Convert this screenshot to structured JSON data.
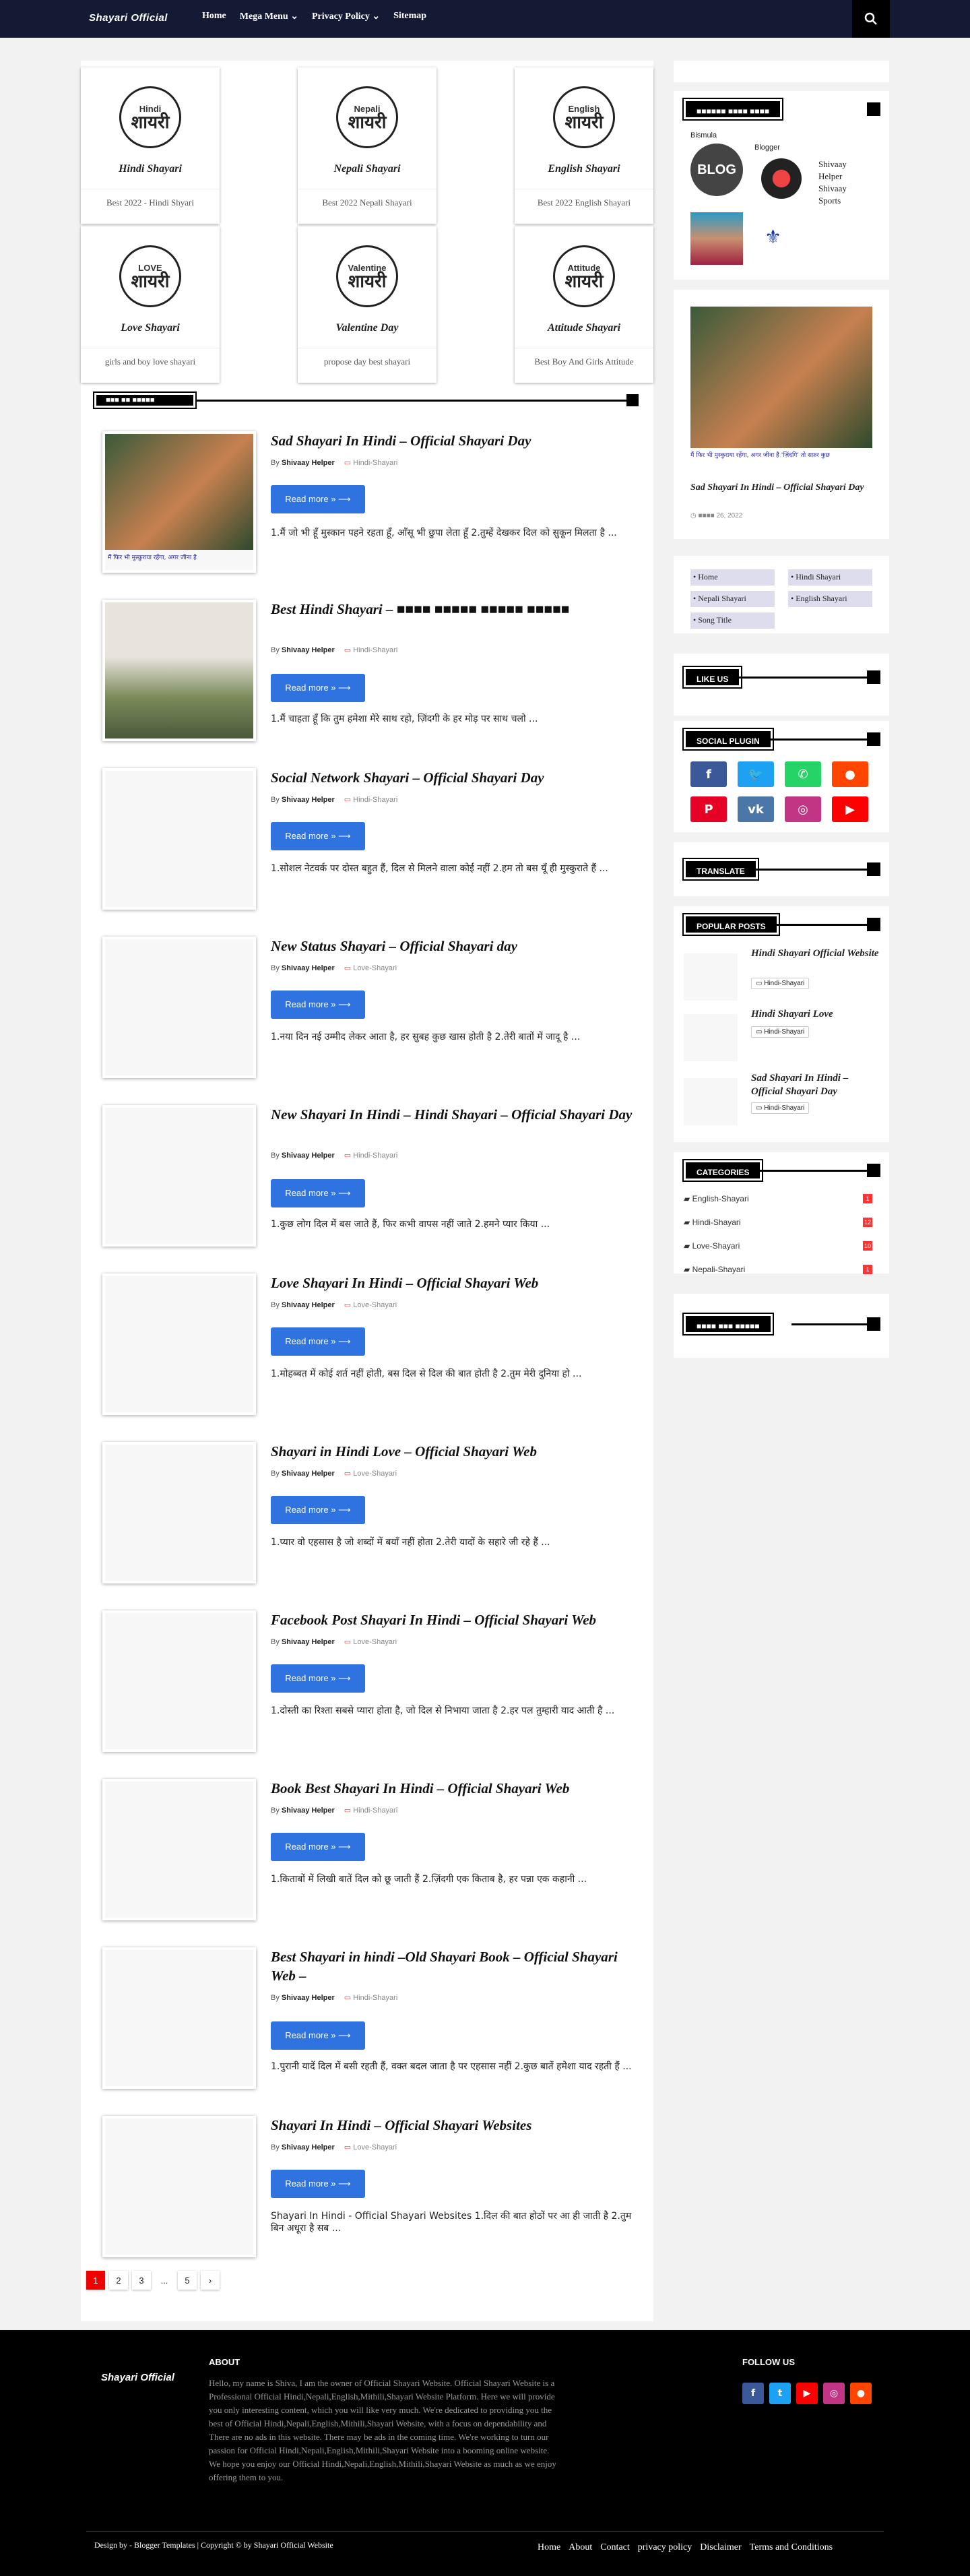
{
  "topbar": {
    "logo": "Shayari Official",
    "nav": [
      "Home",
      "Mega Menu ⌄",
      "Privacy Policy ⌄",
      "Sitemap"
    ]
  },
  "categories_grid": [
    {
      "circle_top": "Hindi",
      "circle_main": "शायरी",
      "title": "Hindi Shayari",
      "desc": "Best 2022 - Hindi Shyari"
    },
    {
      "circle_top": "Nepali",
      "circle_main": "शायरी",
      "title": "Nepali Shayari",
      "desc": "Best 2022 Nepali Shayari"
    },
    {
      "circle_top": "English",
      "circle_main": "शायरी",
      "title": "English Shayari",
      "desc": "Best 2022 English Shayari"
    },
    {
      "circle_top": "LOVE",
      "circle_main": "शायरी",
      "title": "Love Shayari",
      "desc": "girls and boy love shayari"
    },
    {
      "circle_top": "Valentine",
      "circle_main": "शायरी",
      "title": "Valentine Day",
      "desc": "propose day best shayari"
    },
    {
      "circle_top": "Attitude",
      "circle_main": "शायरी",
      "title": "Attitude Shayari",
      "desc": "Best Boy And Girls Attitude"
    }
  ],
  "posts": [
    {
      "title": "Sad Shayari In Hindi – Official Shayari Day",
      "author": "Shivaay Helper",
      "by": "By",
      "cat": "Hindi-Shayari",
      "read": "Read more » ⟶",
      "excerpt": "1.मैं जो भी हूँ मुस्कान पहने रहता हूँ, आँसू भी छुपा लेता हूँ 2.तुम्हें देखकर दिल को सुकून मिलता है ..."
    },
    {
      "title": "Best Hindi Shayari – ■■■■ ■■■■■ ■■■■■ ■■■■■",
      "author": "Shivaay Helper",
      "by": "By",
      "cat": "Hindi-Shayari",
      "read": "Read more » ⟶",
      "excerpt": "1.मैं चाहता हूँ कि तुम हमेशा मेरे साथ रहो, ज़िंदगी के हर मोड़ पर साथ चलो ..."
    },
    {
      "title": "Social Network Shayari – Official Shayari Day",
      "author": "Shivaay Helper",
      "by": "By",
      "cat": "Hindi-Shayari",
      "read": "Read more » ⟶",
      "excerpt": "1.सोशल नेटवर्क पर दोस्त बहुत हैं, दिल से मिलने वाला कोई नहीं 2.हम तो बस यूँ ही मुस्कुराते हैं ..."
    },
    {
      "title": "New Status Shayari – Official Shayari day",
      "author": "Shivaay Helper",
      "by": "By",
      "cat": "Love-Shayari",
      "read": "Read more » ⟶",
      "excerpt": "1.नया दिन नई उम्मीद लेकर आता है, हर सुबह कुछ खास होती है 2.तेरी बातों में जादू है ..."
    },
    {
      "title": "New Shayari In Hindi – Hindi Shayari – Official Shayari Day",
      "author": "Shivaay Helper",
      "by": "By",
      "cat": "Hindi-Shayari",
      "read": "Read more » ⟶",
      "excerpt": "1.कुछ लोग दिल में बस जाते हैं, फिर कभी वापस नहीं जाते 2.हमने प्यार किया ..."
    },
    {
      "title": "Love Shayari In Hindi – Official Shayari Web",
      "author": "Shivaay Helper",
      "by": "By",
      "cat": "Love-Shayari",
      "read": "Read more » ⟶",
      "excerpt": "1.मोहब्बत में कोई शर्त नहीं होती, बस दिल से दिल की बात होती है 2.तुम मेरी दुनिया हो ..."
    },
    {
      "title": "Shayari in Hindi Love – Official Shayari Web",
      "author": "Shivaay Helper",
      "by": "By",
      "cat": "Love-Shayari",
      "read": "Read more » ⟶",
      "excerpt": "1.प्यार वो एहसास है जो शब्दों में बयाँ नहीं होता 2.तेरी यादों के सहारे जी रहे हैं ..."
    },
    {
      "title": "Facebook Post Shayari In Hindi – Official Shayari Web",
      "author": "Shivaay Helper",
      "by": "By",
      "cat": "Love-Shayari",
      "read": "Read more » ⟶",
      "excerpt": "1.दोस्ती का रिश्ता सबसे प्यारा होता है, जो दिल से निभाया जाता है 2.हर पल तुम्हारी याद आती है ..."
    },
    {
      "title": "Book Best Shayari In Hindi – Official Shayari Web",
      "author": "Shivaay Helper",
      "by": "By",
      "cat": "Hindi-Shayari",
      "read": "Read more » ⟶",
      "excerpt": "1.किताबों में लिखी बातें दिल को छू जाती हैं 2.ज़िंदगी एक किताब है, हर पन्ना एक कहानी ..."
    },
    {
      "title": "Best Shayari in hindi –Old Shayari Book – Official Shayari Web –",
      "author": "Shivaay Helper",
      "by": "By",
      "cat": "Hindi-Shayari",
      "read": "Read more » ⟶",
      "excerpt": "1.पुरानी यादें दिल में बसी रहती हैं, वक्त बदल जाता है पर एहसास नहीं 2.कुछ बातें हमेशा याद रहती हैं ..."
    },
    {
      "title": "Shayari In Hindi – Official Shayari Websites",
      "author": "Shivaay Helper",
      "by": "By",
      "cat": "Love-Shayari",
      "read": "Read more » ⟶",
      "excerpt": "Shayari In Hindi - Official Shayari Websites 1.दिल की बात होठों पर आ ही जाती है 2.तुम बिन अधूरा है सब ..."
    }
  ],
  "pager": [
    "1",
    "2",
    "3",
    "...",
    "5",
    "›"
  ],
  "sidebar": {
    "followers_head": "■■■■■■ ■■■■ ■■■■",
    "followers_label1": "Bismula",
    "followers_label2": "Blogger",
    "blog_badge": "BLOG",
    "followers": [
      "Shivaay",
      "Helper",
      "Shivaay",
      "Sports"
    ],
    "featured_title": "Sad Shayari In Hindi – Official Shayari Day",
    "featured_date": "◷ ■■■■ 26, 2022",
    "featured_caption": "मैं फिर भी मुस्कुराया रहेंगा, अगर जीना है 'ज़िंदगि' तो सफ़र कुछ",
    "links": [
      "• Home",
      "• Hindi Shayari",
      "• Nepali Shayari",
      "• English Shayari",
      "• Song Title"
    ],
    "like_us": "LIKE US",
    "social_plugin": "SOCIAL PLUGIN",
    "translate": "TRANSLATE",
    "popular_posts": "POPULAR POSTS",
    "popular": [
      {
        "title": "Hindi Shayari Official Website",
        "cat": "▭ Hindi-Shayari"
      },
      {
        "title": "Hindi Shayari Love",
        "cat": "▭ Hindi-Shayari"
      },
      {
        "title": "Sad Shayari In Hindi – Official Shayari Day",
        "cat": "▭ Hindi-Shayari"
      }
    ],
    "categories_head": "CATEGORIES",
    "categories": [
      {
        "name": "English-Shayari",
        "count": "1"
      },
      {
        "name": "Hindi-Shayari",
        "count": "12"
      },
      {
        "name": "Love-Shayari",
        "count": "10"
      },
      {
        "name": "Nepali-Shayari",
        "count": "1"
      }
    ],
    "last_head": "■■■■ ■■■ ■■■■■"
  },
  "section_head": "■■■ ■■ ■■■■■",
  "footer": {
    "logo": "Shayari Official",
    "about_head": "ABOUT",
    "about_text": "Hello, my name is Shiva, I am the owner of Official Shayari Website. Official Shayari Website is a Professional Official Hindi,Nepali,English,Mithili,Shayari Website Platform. Here we will provide you only interesting content, which you will like very much. We're dedicated to providing you the best of Official Hindi,Nepali,English,Mithili,Shayari Website, with a focus on dependability and There are no ads in this website. There may be ads in the coming time. We're working to turn our passion for Official Hindi,Nepali,English,Mithili,Shayari Website into a booming online website. We hope you enjoy our Official Hindi,Nepali,English,Mithili,Shayari Website as much as we enjoy offering them to you.",
    "follow_head": "FOLLOW US",
    "copyright": "Design by - Blogger Templates | Copyright © by Shayari Official Website",
    "links": [
      "Home",
      "About",
      "Contact",
      "privacy policy",
      "Disclaimer",
      "Terms and Conditions"
    ]
  },
  "colors": {
    "nav_bg": "#141a33",
    "button": "#2f73e0",
    "accent": "#e00000",
    "footer_bg": "#000000"
  }
}
